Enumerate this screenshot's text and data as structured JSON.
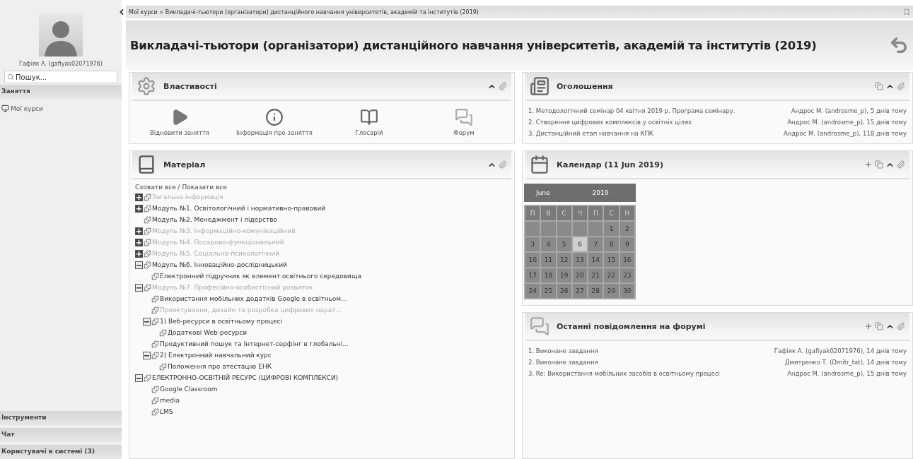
{
  "sidebar": {
    "user": "Гафіяк А. (gafiyak02071976)",
    "search": {
      "placeholder": "Пошук..."
    },
    "sections": [
      {
        "title": "Заняття",
        "items": [
          "Мої курси"
        ]
      }
    ],
    "bottom_sections": [
      "Інструменти",
      "Чат",
      "Користувачі в системі  (3)"
    ]
  },
  "breadcrumb": {
    "items": [
      "Мої курси",
      "Викладачі-тьютори (організатори) дистанційного навчання університетів, академій та інститутів (2019)"
    ],
    "separator": "»"
  },
  "page_title": "Викладачі-тьютори (організатори) дистанційного навчання університетів, академій та інститутів (2019)",
  "properties": {
    "title": "Властивості",
    "actions": [
      {
        "kind": "play",
        "label": "Відновити заняття"
      },
      {
        "kind": "info",
        "label": "Інформація про заняття"
      },
      {
        "kind": "book",
        "label": "Глосарій"
      },
      {
        "kind": "forum",
        "label": "Форум"
      }
    ]
  },
  "material": {
    "title": "Матеріал",
    "toggle_all": "Сховати все / Показати все",
    "tree": [
      {
        "title": "Загальна інформація",
        "dimmed": true,
        "expanded": false
      },
      {
        "title": "Модуль №1. Освітологічний і нормативно-правовий",
        "dimmed": false,
        "expanded": false
      },
      {
        "title": "Модуль №2. Менеджмент і лідерство",
        "dimmed": false
      },
      {
        "title": "Модуль №3. Інформаційно-комунікаційний",
        "dimmed": true,
        "expanded": false
      },
      {
        "title": "Модуль №4. Посадово-функціональний",
        "dimmed": true,
        "expanded": false
      },
      {
        "title": "Модуль №5. Соціально-психологічний",
        "dimmed": true,
        "expanded": false
      },
      {
        "title": "Модуль №6. Інноваційно-дослідницький",
        "dimmed": false,
        "expanded": true,
        "children": [
          {
            "title": "Електронний підручник як елемент освітнього середовища",
            "dimmed": false
          }
        ]
      },
      {
        "title": "Модуль №7. Професійно-особистісний розвиток",
        "dimmed": true,
        "expanded": true,
        "children": [
          {
            "title": "Використання мобільних додатків Google в освітньом...",
            "dimmed": false
          },
          {
            "title": "Проектування, дизайн та розробка цифрових нарат...",
            "dimmed": true
          },
          {
            "title": "1) Веб-ресурси в освітньому процесі",
            "dimmed": false,
            "expanded": true,
            "children": [
              {
                "title": "Додаткові Web-ресурси",
                "dimmed": false
              }
            ]
          },
          {
            "title": "Продуктивний пошук та Інтернет-серфінг в глобальні...",
            "dimmed": false
          },
          {
            "title": "2) Електронний навчальний курс",
            "dimmed": false,
            "expanded": true,
            "children": [
              {
                "title": "Положення про атестацію ЕНК",
                "dimmed": false
              }
            ]
          }
        ]
      },
      {
        "title": "ЕЛЕКТРОННО-ОСВІТНІЙ РЕСУРС (ЦИФРОВІ КОМПЛЕКСИ)",
        "dimmed": false,
        "expanded": true,
        "children": [
          {
            "title": "Google Classroom",
            "dimmed": false
          },
          {
            "title": "media",
            "dimmed": false
          },
          {
            "title": "LMS",
            "dimmed": false
          }
        ]
      }
    ]
  },
  "announcements": {
    "title": "Оголошення",
    "items": [
      {
        "title": "1. Методологічний семінар 04 квітня 2019 р. Програма семінару.",
        "meta": "Андрос М. (androsme_p), 5 днів тому"
      },
      {
        "title": "2. Створення цифрових комплексів у освітніх цілях",
        "meta": "Андрос М. (androsme_p), 15 днів тому"
      },
      {
        "title": "3. Дистанційний етап навчання на КПК",
        "meta": "Андрос М. (androsme_p), 118 днів тому"
      }
    ]
  },
  "calendar": {
    "title": "Календар (11 Jun 2019)",
    "month": "June",
    "year": "2019",
    "weekdays": [
      "П",
      "В",
      "С",
      "Ч",
      "П",
      "С",
      "Н"
    ],
    "weeks": [
      [
        {
          "day": "1",
          "selected": false
        },
        {
          "day": "2",
          "selected": false
        }
      ],
      [
        {
          "day": "3",
          "selected": false
        },
        {
          "day": "4",
          "selected": false
        },
        {
          "day": "5",
          "selected": false
        },
        {
          "day": "6",
          "selected": true
        },
        {
          "day": "7",
          "selected": false
        },
        {
          "day": "8",
          "selected": false
        },
        {
          "day": "9",
          "selected": false
        }
      ],
      [
        {
          "day": "10",
          "selected": false
        },
        {
          "day": "11",
          "selected": false
        },
        {
          "day": "12",
          "selected": false
        },
        {
          "day": "13",
          "selected": false
        },
        {
          "day": "14",
          "selected": false
        },
        {
          "day": "15",
          "selected": false
        },
        {
          "day": "16",
          "selected": false
        }
      ],
      [
        {
          "day": "17",
          "selected": false
        },
        {
          "day": "18",
          "selected": false
        },
        {
          "day": "19",
          "selected": false
        },
        {
          "day": "20",
          "selected": false
        },
        {
          "day": "21",
          "selected": false
        },
        {
          "day": "22",
          "selected": false
        },
        {
          "day": "23",
          "selected": false
        }
      ],
      [
        {
          "day": "24",
          "selected": false
        },
        {
          "day": "25",
          "selected": false
        },
        {
          "day": "26",
          "selected": false
        },
        {
          "day": "27",
          "selected": false
        },
        {
          "day": "28",
          "selected": false
        },
        {
          "day": "29",
          "selected": false
        },
        {
          "day": "30",
          "selected": false
        }
      ]
    ]
  },
  "forum": {
    "title": "Останні повідомлення на форумі",
    "items": [
      {
        "title": "1. Виконане завдання",
        "meta": "Гафіяк А. (gafiyak02071976), 14 днів тому"
      },
      {
        "title": "2. Виконане завдання",
        "meta": "Дмитренко Т. (Dmitr_tat), 14 днів тому"
      },
      {
        "title": "3. Re: Використання мобільних засобів в освітньому процесі",
        "meta": "Андрос М. (androsme_p), 15 днів тому"
      }
    ]
  }
}
